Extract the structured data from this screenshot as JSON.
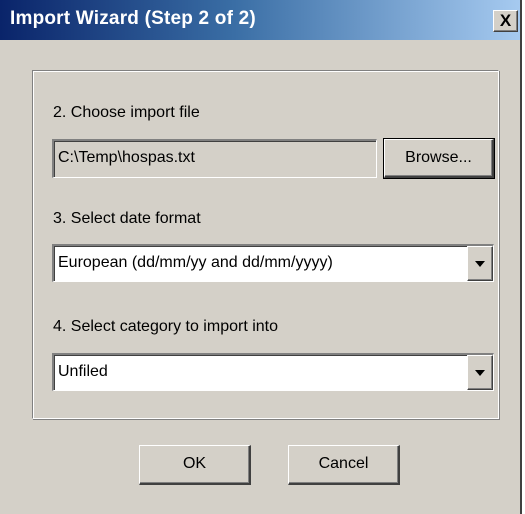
{
  "window": {
    "title": "Import Wizard (Step 2 of 2)",
    "close_label": "X"
  },
  "file_section": {
    "label": "2. Choose import file",
    "file_path": "C:\\Temp\\hospas.txt",
    "browse_label": "Browse..."
  },
  "date_section": {
    "label": "3. Select date format",
    "selected": "European (dd/mm/yy and dd/mm/yyyy)"
  },
  "category_section": {
    "label": "4. Select category to import into",
    "selected": "Unfiled"
  },
  "buttons": {
    "ok_label": "OK",
    "cancel_label": "Cancel"
  },
  "icons": {
    "close": "close-icon",
    "dropdown": "chevron-down-icon"
  },
  "colors": {
    "title_start": "#0a246a",
    "title_end": "#a6caf0",
    "face": "#d4d0c8"
  }
}
